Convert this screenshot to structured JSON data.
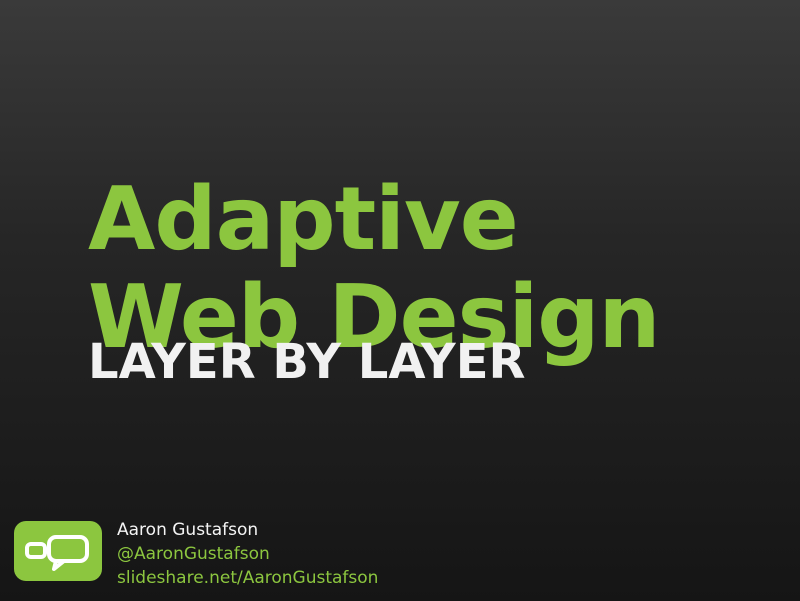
{
  "slide": {
    "title_line1": "Adaptive",
    "title_line2": "Web Design",
    "subtitle": "LAYER BY LAYER"
  },
  "author": {
    "name": "Aaron Gustafson",
    "handle": "@AaronGustafson",
    "link": "slideshare.net/AaronGustafson"
  },
  "colors": {
    "accent": "#8cc63f",
    "background_top": "#3a3a3a",
    "background_bottom": "#151515",
    "subtitle": "#f1f1f1"
  },
  "icons": {
    "logo": "chat-bubbles-logo-icon"
  }
}
